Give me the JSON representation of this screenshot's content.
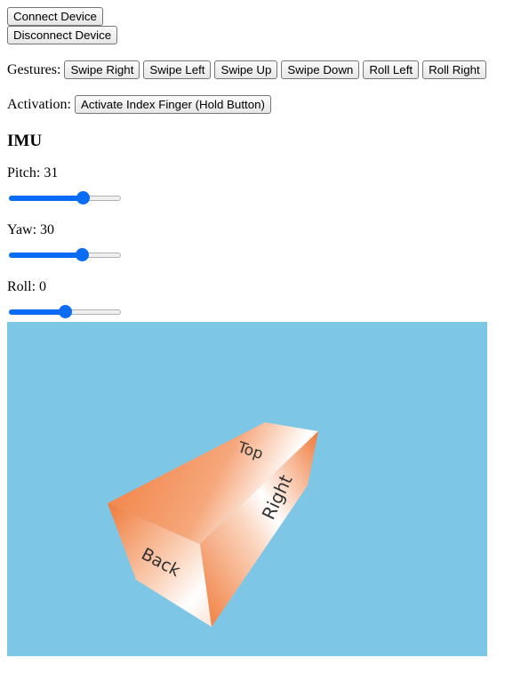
{
  "device": {
    "connect_label": "Connect Device",
    "disconnect_label": "Disconnect Device"
  },
  "gestures": {
    "label": "Gestures:",
    "buttons": [
      "Swipe Right",
      "Swipe Left",
      "Swipe Up",
      "Swipe Down",
      "Roll Left",
      "Roll Right"
    ]
  },
  "activation": {
    "label": "Activation:",
    "button_label": "Activate Index Finger (Hold Button)"
  },
  "imu": {
    "heading": "IMU",
    "pitch_text": "Pitch: 31",
    "pitch_value": 31,
    "yaw_text": "Yaw: 30",
    "yaw_value": 30,
    "roll_text": "Roll: 0",
    "roll_value": 0,
    "slider_min": -90,
    "slider_max": 90
  },
  "scene": {
    "background_color": "#7ec6e6",
    "face_color": "#f07a3a",
    "face_labels": {
      "top": "Top",
      "right": "Right",
      "back": "Back"
    }
  }
}
